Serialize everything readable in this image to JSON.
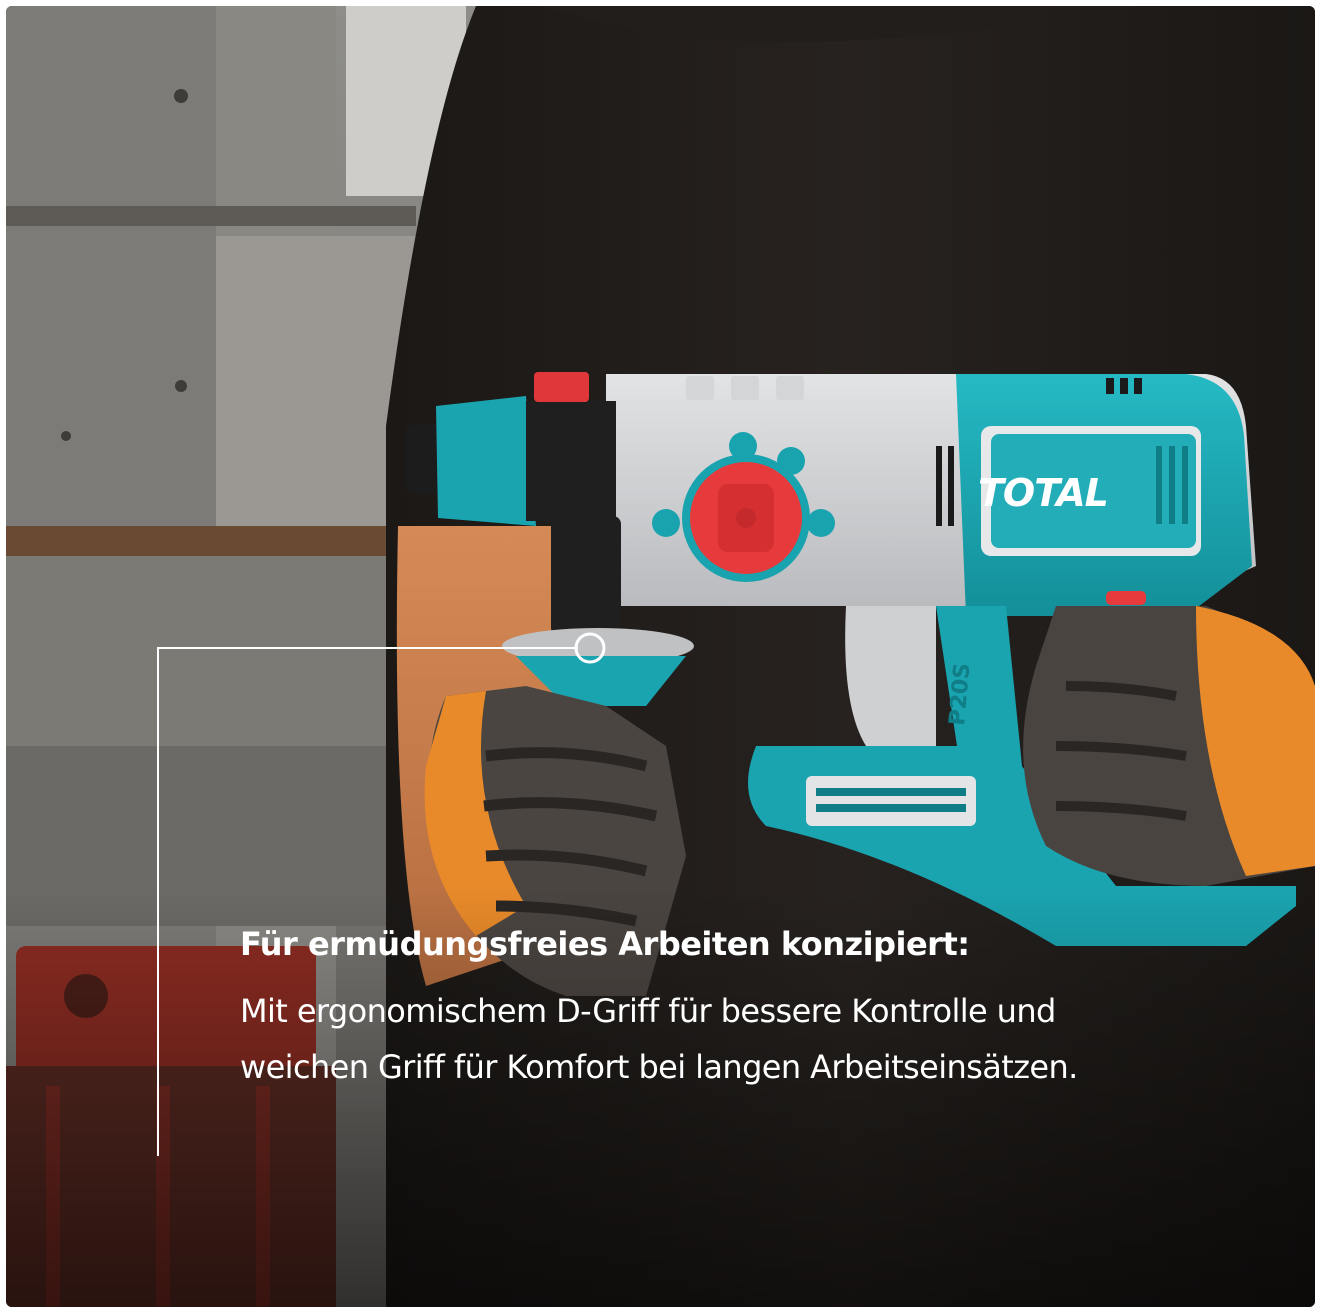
{
  "caption": {
    "title": "Für ermüdungsfreies Arbeiten konzipiert:",
    "body": "Mit ergonomischem D-Griff für bessere Kontrolle und weichen Griff für Komfort bei langen Arbeitseinsätzen."
  },
  "product": {
    "brand_logo": "TOTAL",
    "model_mark": "P20S"
  },
  "colors": {
    "brand_teal": "#1ba7b3",
    "body_grey": "#c9cbce",
    "selector_red": "#e63a3c",
    "shirt_dark": "#1f1c1a",
    "glove_orange": "#e88a2a"
  }
}
